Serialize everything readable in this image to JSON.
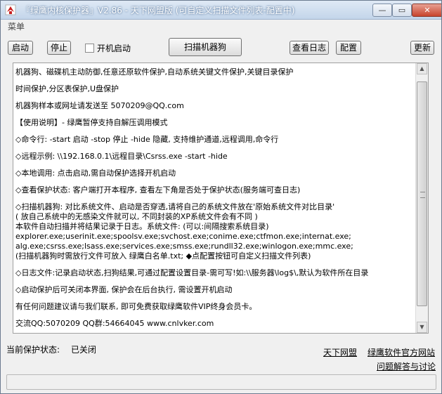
{
  "window": {
    "title": "『绿鹰内核保护器』V2.86 - 天下网盟版 (可自定义扫描文件列表-配置中)",
    "minimize_glyph": "—",
    "maximize_glyph": "▭",
    "close_glyph": "✕"
  },
  "menubar": {
    "menu_label": "菜单"
  },
  "toolbar": {
    "start_label": "启动",
    "stop_label": "停止",
    "autostart_label": "开机启动",
    "autostart_checked": false,
    "scan_label": "扫描机器狗",
    "log_label": "查看日志",
    "config_label": "配置",
    "update_label": "更新"
  },
  "content": {
    "lines": [
      "机器狗、磁碟机主动防御,任意还原软件保护,自动系统关键文件保护,关键目录保护",
      "时间保护,分区表保护,U盘保护",
      "机器狗样本或网址请发送至 5070209@QQ.com",
      "【使用说明】- 绿鹰暂停支持自解压调用模式",
      "◇命令行: -start 启动  -stop 停止 -hide 隐藏, 支持维护通道,远程调用,命令行",
      "◇远程示例: \\\\192.168.0.1\\远程目录\\Csrss.exe -start -hide",
      "◇本地调用: 点击启动,需自动保护选择开机启动",
      "◇查看保护状态: 客户端打开本程序, 查看左下角是否处于保护状态(服务端可查日志)",
      "◇扫描机器狗: 对比系统文件、启动是否穿透,请将自己的系统文件放在'原始系统文件对比目录'",
      "  ( 放自己系统中的无感染文件就可以, 不同封装的XP系统文件会有不同 )",
      "  本软件自动扫描并将结果记录于日志。系统文件: (可以:间隔搜索系统目录)",
      "  explorer.exe;userinit.exe;spoolsv.exe;svchost.exe;conime.exe;ctfmon.exe;internat.exe;",
      "  alg.exe;csrss.exe;lsass.exe;services.exe;smss.exe;rundll32.exe;winlogon.exe;mmc.exe;",
      "  (扫描机器狗时需放行文件可放入 绿鹰白名单.txt; ◆点配置按钮可自定义扫描文件列表)",
      "◇日志文件:记录启动状态,扫狗结果,可通过配置设置目录-需可写!如:\\\\服务器\\log$\\,默认为软件所在目录",
      "◇启动保护后可关闭本界面, 保护会在后台执行, 需设置开机启动",
      "有任何问题建议请与我们联系, 即可免费获取绿鹰软件VIP终身会员卡。",
      "交流QQ:5070209 QQ群:54664045 www.cnlvker.com"
    ]
  },
  "footer": {
    "status_label": "当前保护状态:",
    "status_value": "已关闭",
    "link_alliance": "天下网盟",
    "link_official": "绿鹰软件官方网站",
    "link_faq": "问题解答与讨论"
  },
  "colors": {
    "titlebar": "#c3d5ea",
    "close_button": "#c7432c"
  }
}
